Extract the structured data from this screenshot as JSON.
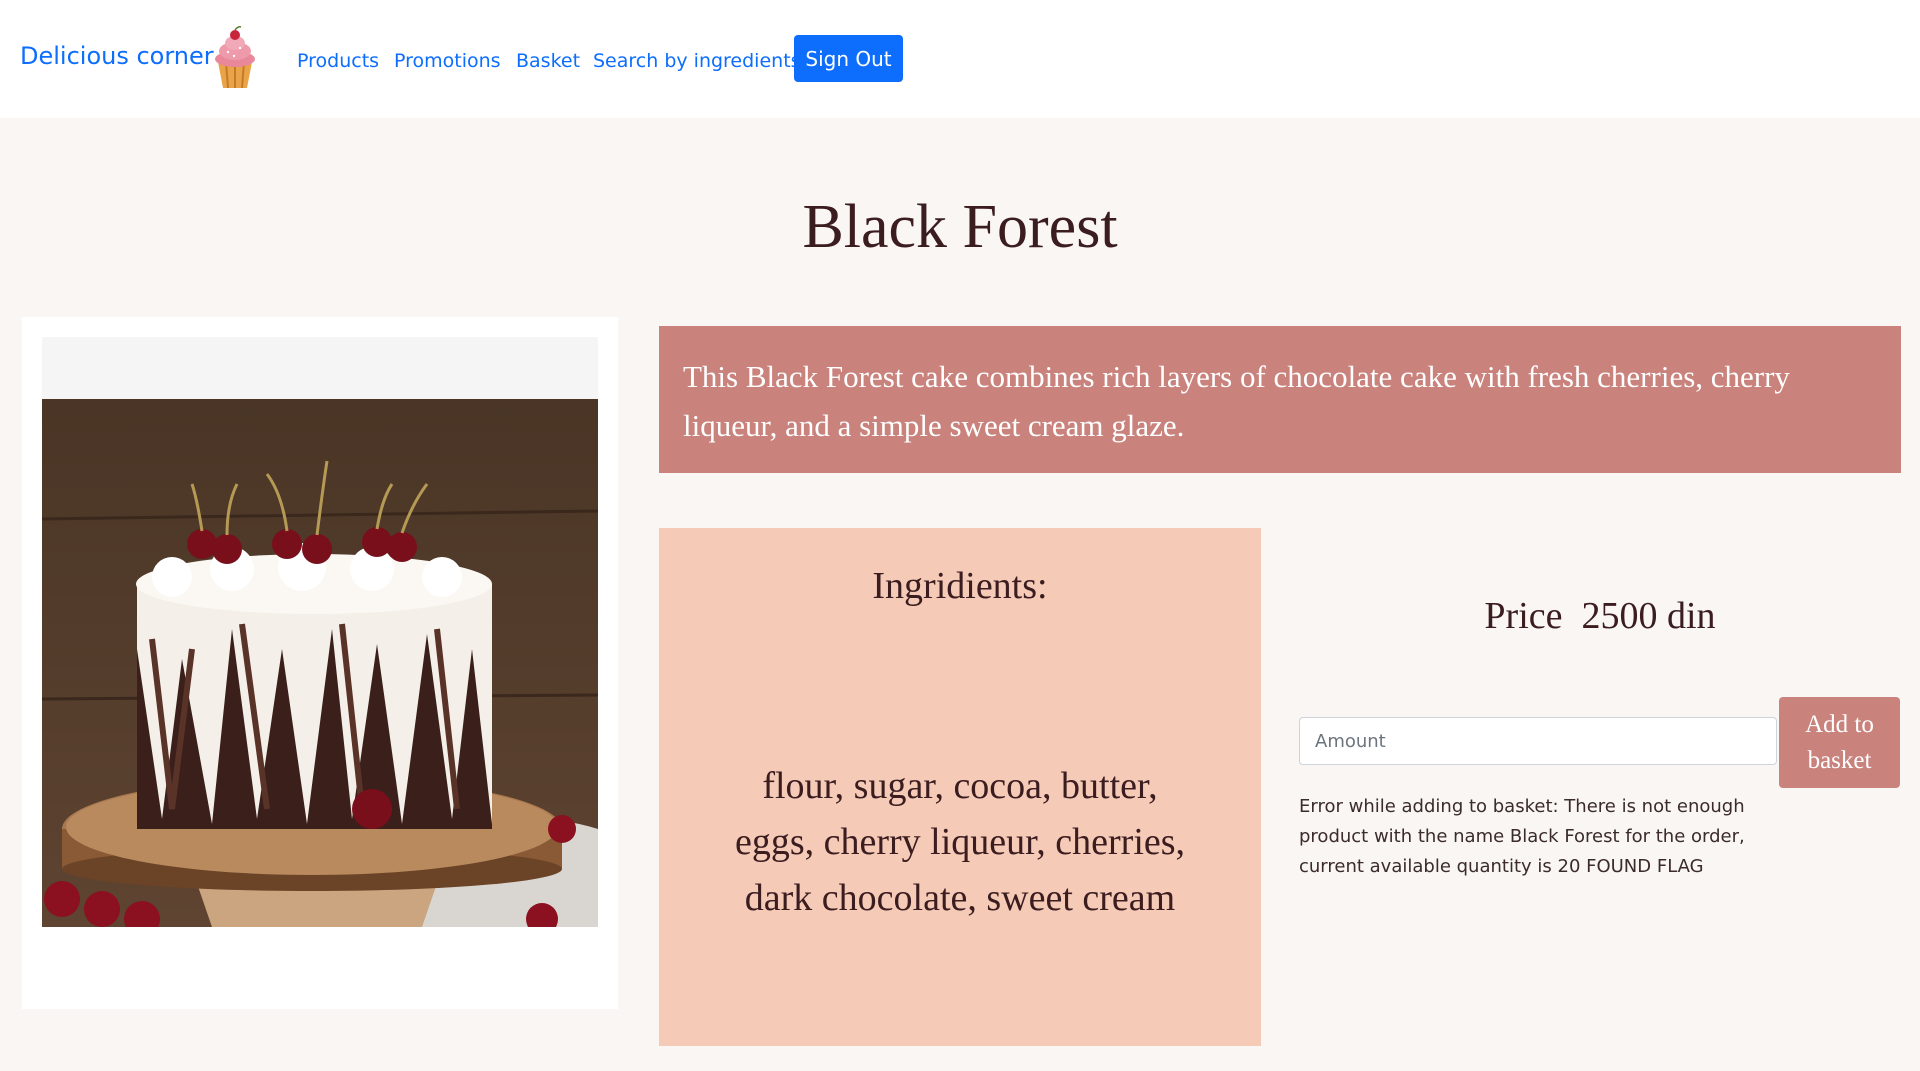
{
  "navbar": {
    "brand": "Delicious corner",
    "links": [
      "Products",
      "Promotions",
      "Basket",
      "Search by ingredients"
    ],
    "signout_label": "Sign Out",
    "link_color": "#0d6efd"
  },
  "product": {
    "title": "Black Forest",
    "description": "This Black Forest cake combines rich layers of chocolate cake with fresh cherries, cherry liqueur, and a simple sweet cream glaze.",
    "ingredients_title": "Ingridients:",
    "ingredients": "flour, sugar, cocoa, butter, eggs, cherry liqueur, cherries, dark chocolate, sweet cream",
    "price_text": "Price  2500 din"
  },
  "basket_form": {
    "amount_placeholder": "Amount",
    "add_button_label": "Add to basket",
    "error_message": "Error while adding to basket: There is not enough product with the name Black Forest for the order, current available quantity is 20 FOUND FLAG"
  },
  "colors": {
    "accent": "#c9827c",
    "ingredients_bg": "#f5cbb8",
    "page_bg": "#f9f6f4",
    "text_dark": "#3b1c1f"
  }
}
